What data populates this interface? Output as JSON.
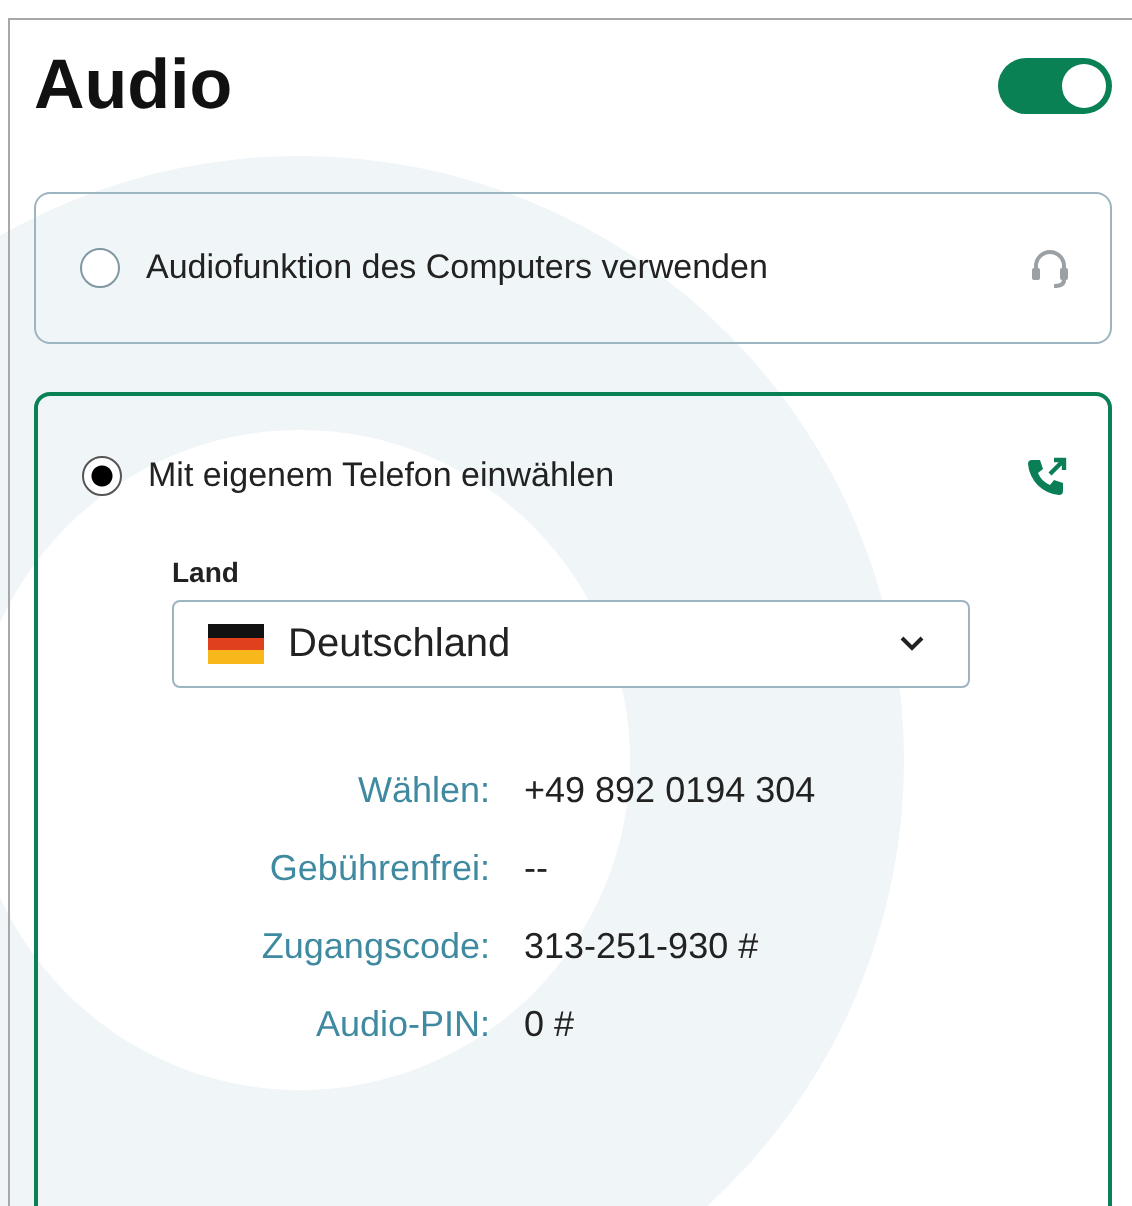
{
  "title": "Audio",
  "toggle": {
    "on": true
  },
  "options": [
    {
      "label": "Audiofunktion des Computers verwenden",
      "selected": false,
      "kind": "computer"
    },
    {
      "label": "Mit eigenem Telefon einwählen",
      "selected": true,
      "kind": "phone",
      "country": {
        "label": "Land",
        "value": "Deutschland"
      },
      "details": [
        {
          "label": "Wählen:",
          "value": "+49 892 0194 304"
        },
        {
          "label": "Gebührenfrei:",
          "value": "--"
        },
        {
          "label": "Zugangscode:",
          "value": "313-251-930 #"
        },
        {
          "label": "Audio-PIN:",
          "value": "0 #"
        }
      ]
    }
  ]
}
